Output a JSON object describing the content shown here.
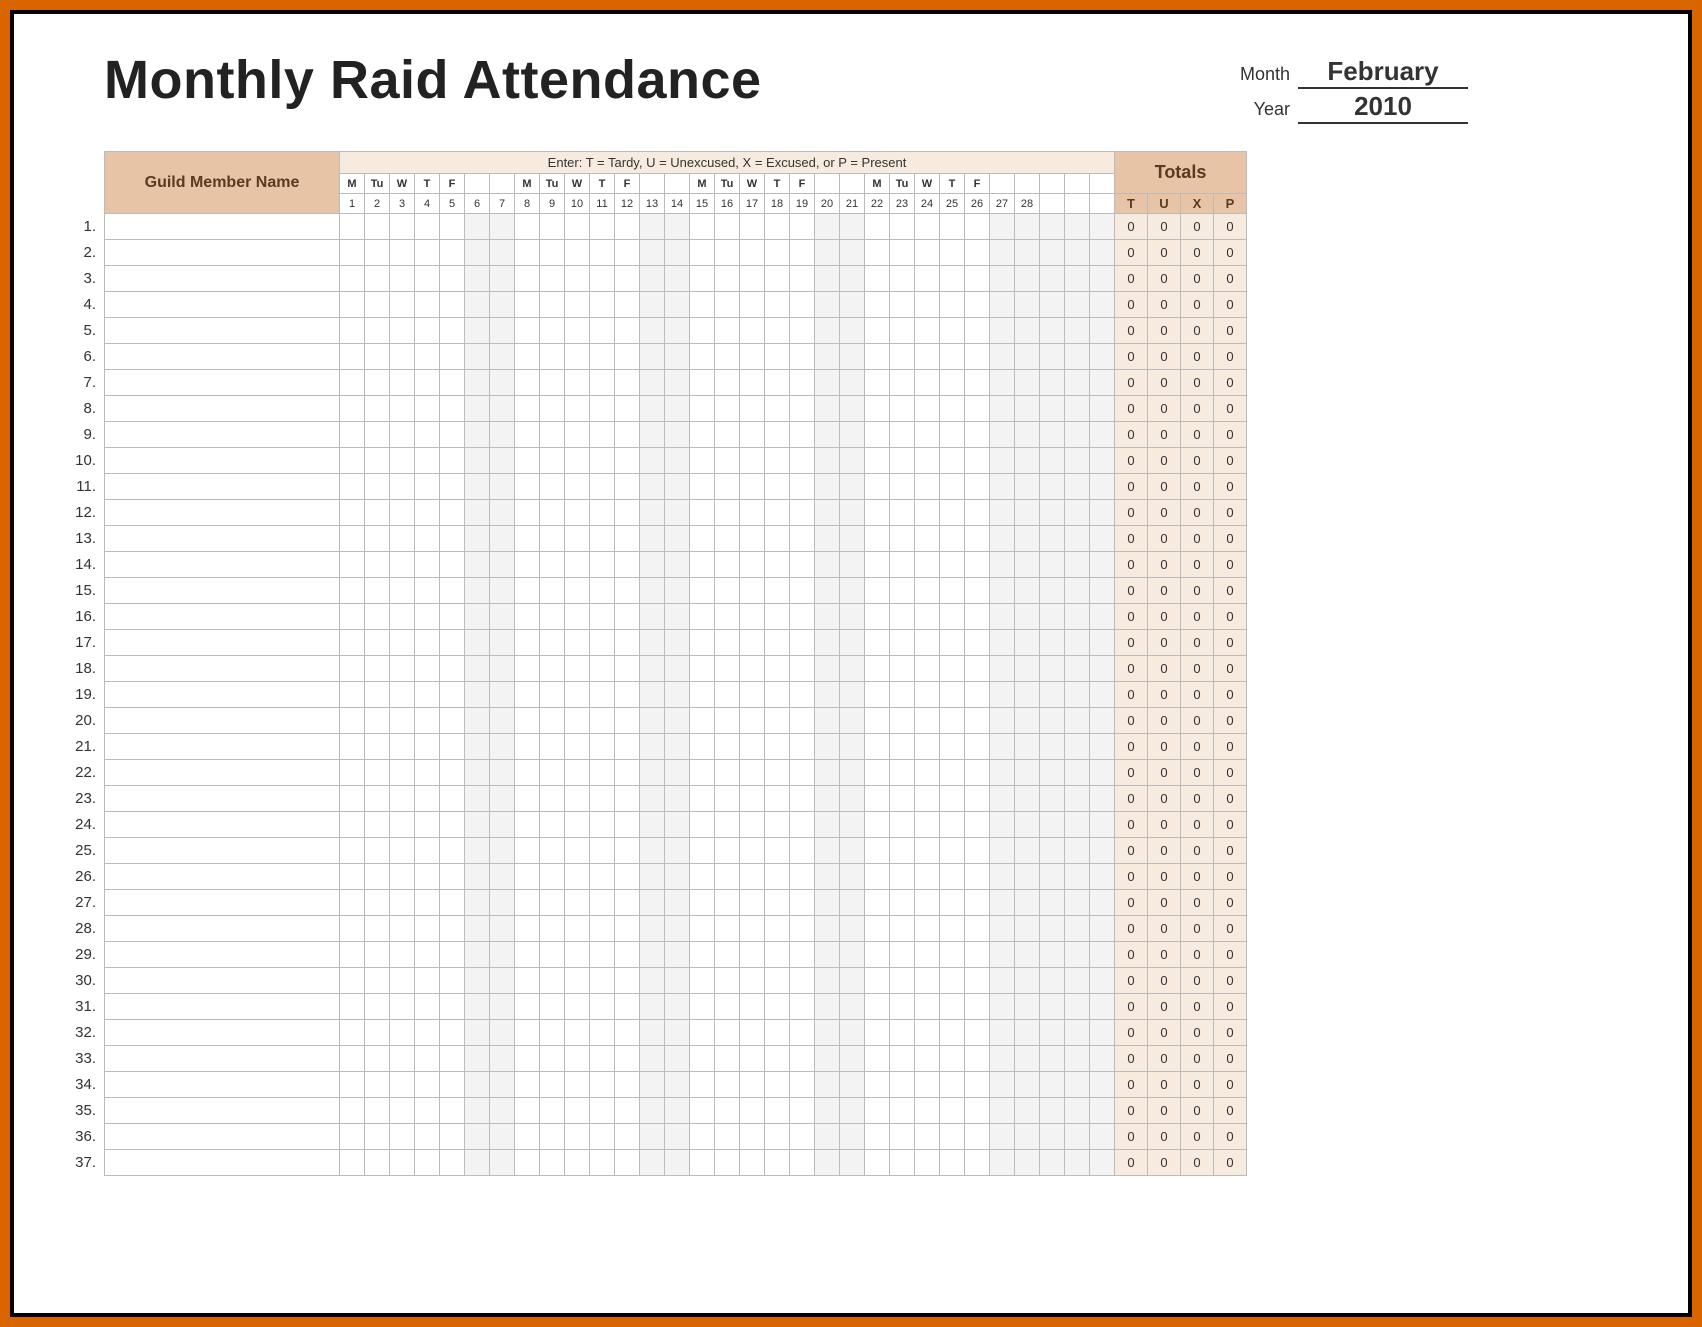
{
  "title": "Monthly Raid Attendance",
  "month_label": "Month",
  "year_label": "Year",
  "month_value": "February",
  "year_value": "2010",
  "name_header": "Guild Member Name",
  "legend_text": "Enter: T = Tardy,  U = Unexcused,  X = Excused,  or P = Present",
  "totals_header": "Totals",
  "totals_cols": [
    "T",
    "U",
    "X",
    "P"
  ],
  "num_days": 28,
  "num_cols": 31,
  "dow_start_index": 0,
  "dow_labels": [
    "M",
    "Tu",
    "W",
    "T",
    "F",
    "",
    ""
  ],
  "rows": [
    {
      "n": "1.",
      "t": 0,
      "u": 0,
      "x": 0,
      "p": 0
    },
    {
      "n": "2.",
      "t": 0,
      "u": 0,
      "x": 0,
      "p": 0
    },
    {
      "n": "3.",
      "t": 0,
      "u": 0,
      "x": 0,
      "p": 0
    },
    {
      "n": "4.",
      "t": 0,
      "u": 0,
      "x": 0,
      "p": 0
    },
    {
      "n": "5.",
      "t": 0,
      "u": 0,
      "x": 0,
      "p": 0
    },
    {
      "n": "6.",
      "t": 0,
      "u": 0,
      "x": 0,
      "p": 0
    },
    {
      "n": "7.",
      "t": 0,
      "u": 0,
      "x": 0,
      "p": 0
    },
    {
      "n": "8.",
      "t": 0,
      "u": 0,
      "x": 0,
      "p": 0
    },
    {
      "n": "9.",
      "t": 0,
      "u": 0,
      "x": 0,
      "p": 0
    },
    {
      "n": "10.",
      "t": 0,
      "u": 0,
      "x": 0,
      "p": 0
    },
    {
      "n": "11.",
      "t": 0,
      "u": 0,
      "x": 0,
      "p": 0
    },
    {
      "n": "12.",
      "t": 0,
      "u": 0,
      "x": 0,
      "p": 0
    },
    {
      "n": "13.",
      "t": 0,
      "u": 0,
      "x": 0,
      "p": 0
    },
    {
      "n": "14.",
      "t": 0,
      "u": 0,
      "x": 0,
      "p": 0
    },
    {
      "n": "15.",
      "t": 0,
      "u": 0,
      "x": 0,
      "p": 0
    },
    {
      "n": "16.",
      "t": 0,
      "u": 0,
      "x": 0,
      "p": 0
    },
    {
      "n": "17.",
      "t": 0,
      "u": 0,
      "x": 0,
      "p": 0
    },
    {
      "n": "18.",
      "t": 0,
      "u": 0,
      "x": 0,
      "p": 0
    },
    {
      "n": "19.",
      "t": 0,
      "u": 0,
      "x": 0,
      "p": 0
    },
    {
      "n": "20.",
      "t": 0,
      "u": 0,
      "x": 0,
      "p": 0
    },
    {
      "n": "21.",
      "t": 0,
      "u": 0,
      "x": 0,
      "p": 0
    },
    {
      "n": "22.",
      "t": 0,
      "u": 0,
      "x": 0,
      "p": 0
    },
    {
      "n": "23.",
      "t": 0,
      "u": 0,
      "x": 0,
      "p": 0
    },
    {
      "n": "24.",
      "t": 0,
      "u": 0,
      "x": 0,
      "p": 0
    },
    {
      "n": "25.",
      "t": 0,
      "u": 0,
      "x": 0,
      "p": 0
    },
    {
      "n": "26.",
      "t": 0,
      "u": 0,
      "x": 0,
      "p": 0
    },
    {
      "n": "27.",
      "t": 0,
      "u": 0,
      "x": 0,
      "p": 0
    },
    {
      "n": "28.",
      "t": 0,
      "u": 0,
      "x": 0,
      "p": 0
    },
    {
      "n": "29.",
      "t": 0,
      "u": 0,
      "x": 0,
      "p": 0
    },
    {
      "n": "30.",
      "t": 0,
      "u": 0,
      "x": 0,
      "p": 0
    },
    {
      "n": "31.",
      "t": 0,
      "u": 0,
      "x": 0,
      "p": 0
    },
    {
      "n": "32.",
      "t": 0,
      "u": 0,
      "x": 0,
      "p": 0
    },
    {
      "n": "33.",
      "t": 0,
      "u": 0,
      "x": 0,
      "p": 0
    },
    {
      "n": "34.",
      "t": 0,
      "u": 0,
      "x": 0,
      "p": 0
    },
    {
      "n": "35.",
      "t": 0,
      "u": 0,
      "x": 0,
      "p": 0
    },
    {
      "n": "36.",
      "t": 0,
      "u": 0,
      "x": 0,
      "p": 0
    },
    {
      "n": "37.",
      "t": 0,
      "u": 0,
      "x": 0,
      "p": 0
    }
  ]
}
